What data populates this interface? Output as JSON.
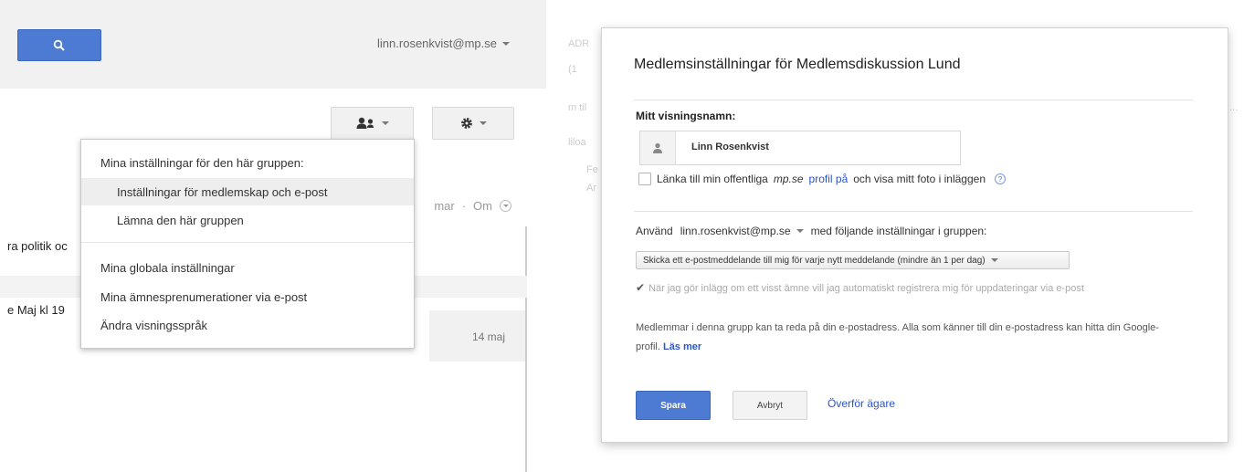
{
  "left": {
    "header": {
      "account_email": "linn.rosenkvist@mp.se"
    },
    "toolbar": {
      "members_icon": "person-add-icon",
      "settings_icon": "gear-icon"
    },
    "background_row": {
      "text1": "mar",
      "dot": "·",
      "text2": "Om"
    },
    "list": {
      "snippet1": "ra politik oc",
      "snippet2": "e Maj kl 19",
      "date": "14 maj"
    },
    "dropdown": {
      "header": "Mina inställningar för den här gruppen:",
      "items": [
        {
          "label": "Inställningar för medlemskap och e-post"
        },
        {
          "label": "Lämna den här gruppen"
        }
      ],
      "global_items": [
        {
          "label": "Mina globala inställningar"
        },
        {
          "label": "Mina ämnesprenumerationer via e-post"
        },
        {
          "label": "Ändra visningsspråk"
        }
      ]
    }
  },
  "right": {
    "background": {
      "t1": "ADR",
      "t2": "(1",
      "t3": "m til",
      "t4": "liloa",
      "t5": "Fe",
      "t6": "Ar",
      "t7": "..."
    },
    "dialog": {
      "title": "Medlemsinställningar för Medlemsdiskussion Lund",
      "display_name_label": "Mitt visningsnamn:",
      "display_name_value": "Linn Rosenkvist",
      "link_profile": {
        "prefix": "Länka till min offentliga",
        "domain": "mp.se",
        "link": "profil på",
        "suffix": "och visa mitt foto i inläggen"
      },
      "use": {
        "prefix": "Använd",
        "email": "linn.rosenkvist@mp.se",
        "suffix": "med följande inställningar i gruppen:"
      },
      "delivery_option": "Skicka ett e-postmeddelande till mig för varje nytt meddelande (mindre än 1 per dag)",
      "auto_subscribe": "När jag gör inlägg om ett visst ämne vill jag automatiskt registrera mig för uppdateringar via e-post",
      "info": {
        "text": "Medlemmar i denna grupp kan ta reda på din e-postadress. Alla som känner till din e-postadress kan hitta din Google-profil.",
        "link": "Läs mer"
      },
      "buttons": {
        "save": "Spara",
        "cancel": "Avbryt",
        "transfer": "Överför ägare"
      }
    }
  }
}
